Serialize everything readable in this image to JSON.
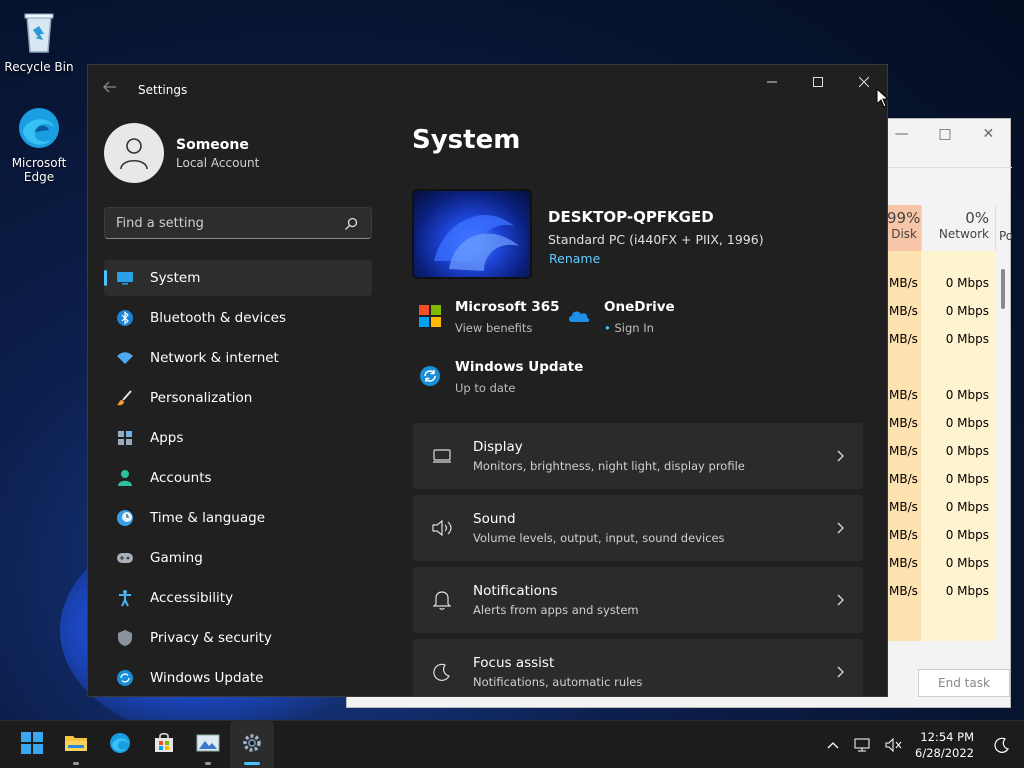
{
  "desktop": {
    "icons": [
      {
        "label": "Recycle Bin"
      },
      {
        "label": "Microsoft Edge"
      }
    ]
  },
  "task_manager": {
    "columns": [
      {
        "percent": "99%",
        "label": "Disk"
      },
      {
        "percent": "0%",
        "label": "Network"
      },
      {
        "label": "Po"
      }
    ],
    "rows": [
      {
        "disk": "MB/s",
        "network": "0 Mbps"
      },
      {
        "disk": "MB/s",
        "network": "0 Mbps"
      },
      {
        "disk": "MB/s",
        "network": "0 Mbps"
      },
      {
        "disk": "",
        "network": ""
      },
      {
        "disk": "MB/s",
        "network": "0 Mbps"
      },
      {
        "disk": "MB/s",
        "network": "0 Mbps"
      },
      {
        "disk": "MB/s",
        "network": "0 Mbps"
      },
      {
        "disk": "MB/s",
        "network": "0 Mbps"
      },
      {
        "disk": "MB/s",
        "network": "0 Mbps"
      },
      {
        "disk": "MB/s",
        "network": "0 Mbps"
      },
      {
        "disk": "MB/s",
        "network": "0 Mbps"
      },
      {
        "disk": "MB/s",
        "network": "0 Mbps"
      }
    ],
    "end_task": "End task"
  },
  "settings": {
    "title": "Settings",
    "profile": {
      "name": "Someone",
      "account": "Local Account"
    },
    "search": {
      "placeholder": "Find a setting"
    },
    "nav": [
      {
        "label": "System",
        "icon": "monitor-icon",
        "active": true
      },
      {
        "label": "Bluetooth & devices",
        "icon": "bluetooth-icon"
      },
      {
        "label": "Network & internet",
        "icon": "wifi-icon"
      },
      {
        "label": "Personalization",
        "icon": "brush-icon"
      },
      {
        "label": "Apps",
        "icon": "apps-icon"
      },
      {
        "label": "Accounts",
        "icon": "person-icon"
      },
      {
        "label": "Time & language",
        "icon": "clock-globe-icon"
      },
      {
        "label": "Gaming",
        "icon": "gamepad-icon"
      },
      {
        "label": "Accessibility",
        "icon": "accessibility-icon"
      },
      {
        "label": "Privacy & security",
        "icon": "shield-icon"
      },
      {
        "label": "Windows Update",
        "icon": "update-icon"
      }
    ],
    "page_title": "System",
    "device": {
      "name": "DESKTOP-QPFKGED",
      "spec": "Standard PC (i440FX + PIIX, 1996)",
      "rename": "Rename"
    },
    "quick": {
      "m365": {
        "title": "Microsoft 365",
        "sub": "View benefits"
      },
      "onedrive": {
        "title": "OneDrive",
        "sub": "Sign In"
      },
      "update": {
        "title": "Windows Update",
        "sub": "Up to date"
      }
    },
    "cards": [
      {
        "title": "Display",
        "sub": "Monitors, brightness, night light, display profile",
        "icon": "display-icon"
      },
      {
        "title": "Sound",
        "sub": "Volume levels, output, input, sound devices",
        "icon": "speaker-icon"
      },
      {
        "title": "Notifications",
        "sub": "Alerts from apps and system",
        "icon": "bell-icon"
      },
      {
        "title": "Focus assist",
        "sub": "Notifications, automatic rules",
        "icon": "moon-icon"
      }
    ]
  },
  "taskbar": {
    "apps": [
      "start-icon",
      "file-explorer-icon",
      "edge-icon",
      "store-icon",
      "photos-icon",
      "settings-icon"
    ],
    "time": "12:54 PM",
    "date": "6/28/2022"
  },
  "colors": {
    "accent": "#4cc2ff",
    "link": "#60cdff",
    "window_bg": "#202020",
    "card_bg": "#2b2b2b"
  }
}
